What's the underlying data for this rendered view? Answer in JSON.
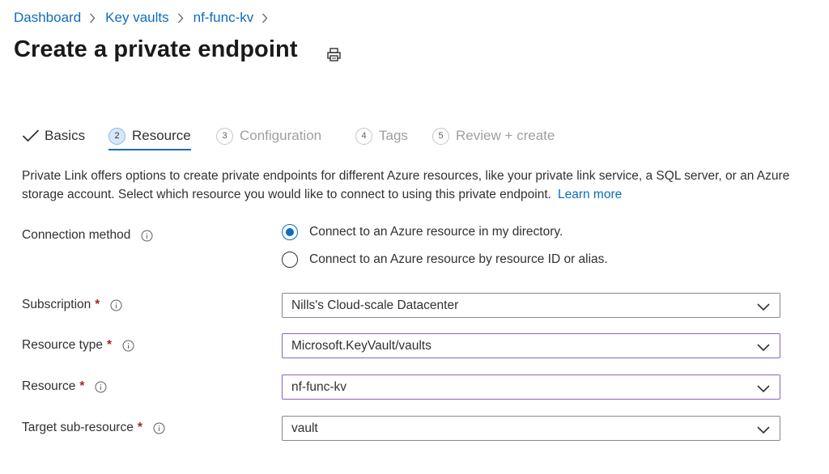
{
  "breadcrumb": {
    "items": [
      "Dashboard",
      "Key vaults",
      "nf-func-kv"
    ]
  },
  "title": "Create a private endpoint",
  "tabs": [
    {
      "label": "Basics",
      "number": "",
      "state": "completed"
    },
    {
      "label": "Resource",
      "number": "2",
      "state": "active"
    },
    {
      "label": "Configuration",
      "number": "3",
      "state": "disabled"
    },
    {
      "label": "Tags",
      "number": "4",
      "state": "disabled"
    },
    {
      "label": "Review + create",
      "number": "5",
      "state": "disabled"
    }
  ],
  "intro": {
    "text": "Private Link offers options to create private endpoints for different Azure resources, like your private link service, a SQL server, or an Azure storage account. Select which resource you would like to connect to using this private endpoint.",
    "link": "Learn more"
  },
  "connection_method": {
    "label": "Connection method",
    "options": [
      {
        "label": "Connect to an Azure resource in my directory.",
        "selected": true
      },
      {
        "label": "Connect to an Azure resource by resource ID or alias.",
        "selected": false
      }
    ]
  },
  "fields": {
    "subscription": {
      "label": "Subscription",
      "required": "*",
      "value": "Nills's Cloud-scale Datacenter"
    },
    "resource_type": {
      "label": "Resource type",
      "required": "*",
      "value": "Microsoft.KeyVault/vaults"
    },
    "resource": {
      "label": "Resource",
      "required": "*",
      "value": "nf-func-kv"
    },
    "target_sub_resource": {
      "label": "Target sub-resource",
      "required": "*",
      "value": "vault"
    }
  },
  "colors": {
    "link": "#0f6cbd",
    "required": "#a4262c",
    "focus_border": "#8764b8",
    "disabled_text": "#a19f9d"
  },
  "icons": {
    "print": "print-icon",
    "info": "info-icon",
    "chevron": "chevron-down-icon",
    "check": "checkmark-icon"
  }
}
